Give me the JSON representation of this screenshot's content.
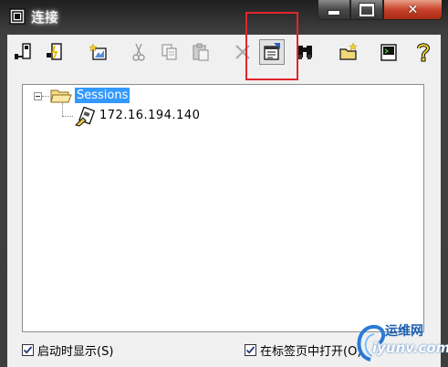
{
  "window": {
    "title": "连接",
    "close_symbol": "✕"
  },
  "toolbar": {
    "buttons": [
      {
        "name": "connect-button",
        "icon": "connect-icon"
      },
      {
        "name": "quick-connect-button",
        "icon": "quick-connect-icon"
      },
      {
        "name": "new-session-button",
        "icon": "new-session-icon"
      },
      {
        "name": "cut-button",
        "icon": "scissors-icon"
      },
      {
        "name": "copy-button",
        "icon": "copy-icon"
      },
      {
        "name": "paste-button",
        "icon": "paste-icon"
      },
      {
        "name": "delete-button",
        "icon": "delete-x-icon"
      },
      {
        "name": "properties-button",
        "icon": "properties-icon",
        "pressed": true
      },
      {
        "name": "find-button",
        "icon": "binoculars-icon"
      },
      {
        "name": "new-folder-button",
        "icon": "new-folder-icon"
      },
      {
        "name": "terminal-button",
        "icon": "terminal-icon"
      },
      {
        "name": "help-button",
        "icon": "question-icon"
      }
    ],
    "highlight_color": "#e0262a"
  },
  "tree": {
    "root": {
      "label": "Sessions",
      "expanded": true,
      "selected": true
    },
    "children": [
      {
        "label": "172.16.194.140"
      }
    ]
  },
  "options": {
    "show_on_startup": {
      "label": "启动时显示(S)",
      "checked": true
    },
    "open_in_tab": {
      "label": "在标签页中打开(O)",
      "checked": true
    }
  },
  "watermark": {
    "top": "运维网",
    "bottom": "iyunv.com"
  }
}
